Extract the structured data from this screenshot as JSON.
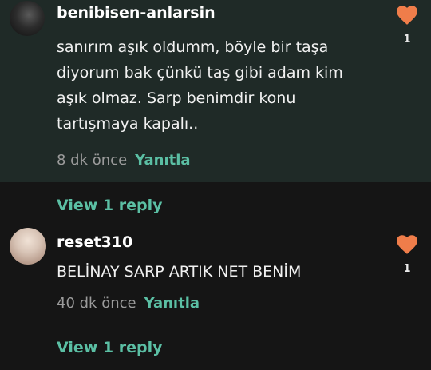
{
  "colors": {
    "accent": "#5bbfa4",
    "heart": "#ef7d4a",
    "highlight_bg": "#1f2a27",
    "page_bg": "#151515"
  },
  "comments": [
    {
      "username": "benibisen-anlarsin",
      "text_lines": [
        "sanırım aşık oldumm, böyle bir taşa",
        "diyorum bak çünkü taş gibi adam kim",
        "aşık olmaz. Sarp benimdir konu",
        "tartışmaya kapalı.."
      ],
      "timestamp": "8 dk önce",
      "reply_label": "Yanıtla",
      "likes": "1",
      "view_replies": "View 1 reply",
      "icon": "heart-icon"
    },
    {
      "username": "reset310",
      "text_lines": [
        "BELİNAY SARP ARTIK NET BENİM"
      ],
      "timestamp": "40 dk önce",
      "reply_label": "Yanıtla",
      "likes": "1",
      "view_replies": "View 1 reply",
      "icon": "heart-icon"
    }
  ]
}
